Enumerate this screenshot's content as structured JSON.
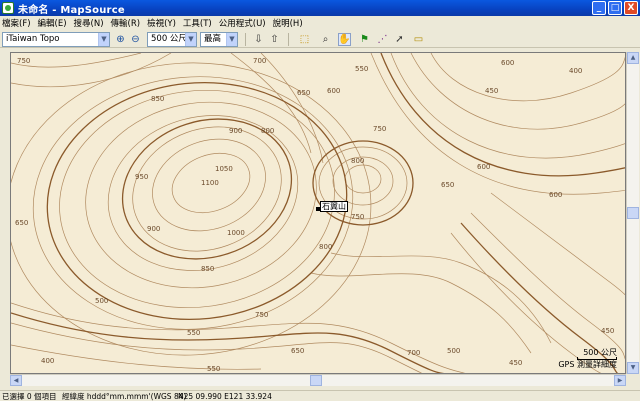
{
  "window": {
    "title": "未命名 - MapSource",
    "minimize": "_",
    "maximize": "□",
    "close": "X"
  },
  "menu": {
    "items": [
      "檔案(F)",
      "編輯(E)",
      "搜尋(N)",
      "傳輸(R)",
      "檢視(Y)",
      "工具(T)",
      "公用程式(U)",
      "說明(H)"
    ]
  },
  "toolbar": {
    "map_product": "iTaiwan Topo",
    "zoom_scale": "500 公尺",
    "detail_level": "最高",
    "icons": [
      "zoom-in-icon",
      "zoom-out-icon",
      "receive-from-device-icon",
      "send-to-device-icon",
      "select-icon",
      "zoom-tool-icon",
      "hand-icon",
      "waypoint-flag-icon",
      "route-icon",
      "pointer-icon",
      "measure-icon"
    ]
  },
  "map": {
    "colors": {
      "background": "#f5ecd5",
      "contour": "#a8835a",
      "index_contour": "#8b5a2b",
      "label": "#6b4a2b"
    },
    "waypoint_label": "石翼山",
    "contour_labels": [
      "750",
      "700",
      "550",
      "600",
      "400",
      "450",
      "850",
      "900",
      "800",
      "650",
      "1050",
      "1100",
      "950",
      "1000",
      "650",
      "600",
      "750",
      "800",
      "650",
      "600",
      "750",
      "900",
      "800",
      "500",
      "850",
      "750",
      "650",
      "550",
      "700",
      "600",
      "450",
      "500",
      "550",
      "400",
      "450"
    ],
    "scale_text": "500 公尺",
    "scale_note": "GPS 測量詳細度"
  },
  "status": {
    "selection": "已選擇 0 個項目",
    "format": "經緯度 hddd°mm.mmm'(WGS 84)",
    "coordinates": "N25 09.990 E121 33.924"
  }
}
